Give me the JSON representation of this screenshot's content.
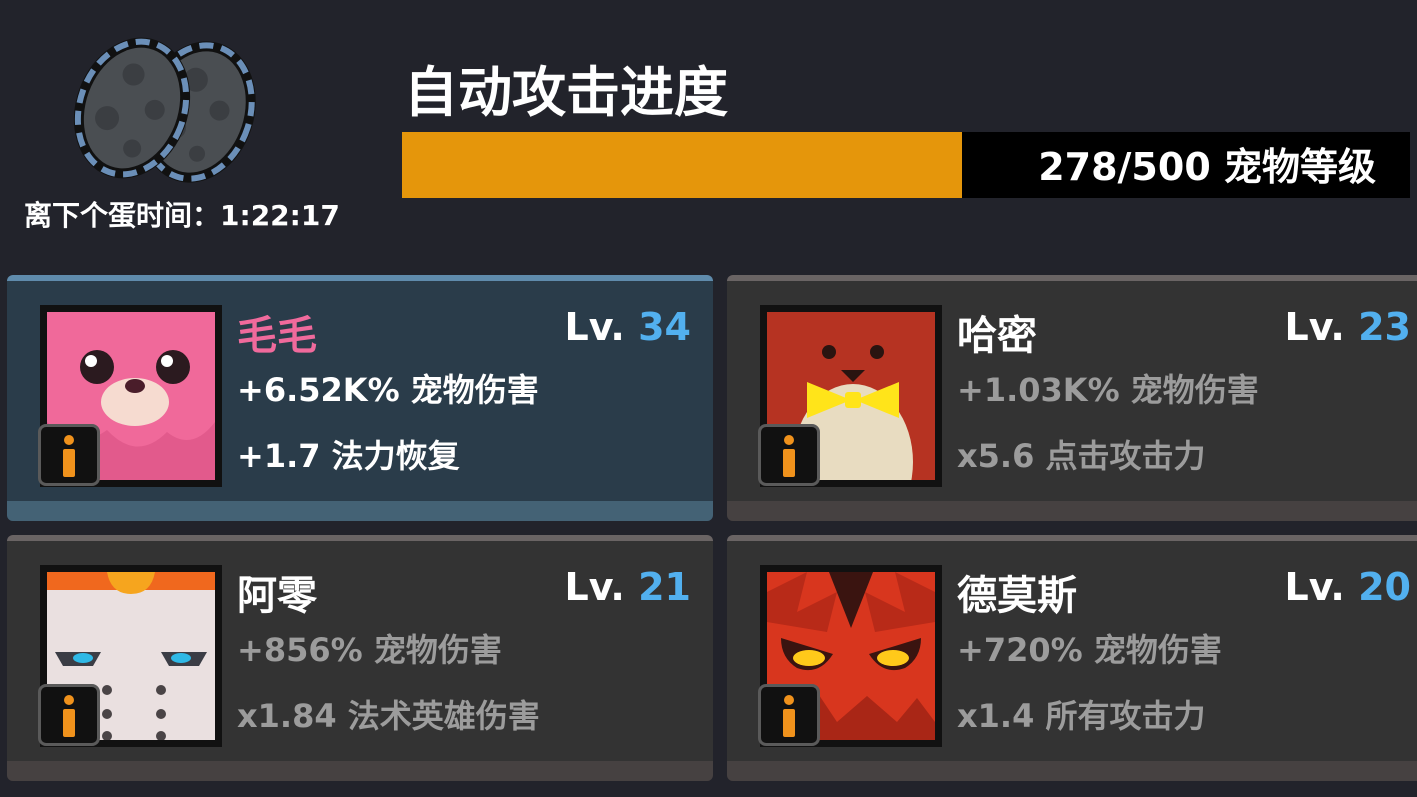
{
  "header": {
    "title": "自动攻击进度",
    "egg_timer_label": "离下个蛋时间：",
    "egg_timer_value": "1:22:17",
    "progress_text": "278/500 宠物等级",
    "progress_current": 278,
    "progress_max": 500,
    "progress_color": "#e5960b"
  },
  "pets": [
    {
      "name": "毛毛",
      "level_prefix": "Lv.",
      "level": "34",
      "stat1": "+6.52K% 宠物伤害",
      "stat2": "+1.7 法力恢复",
      "selected": true,
      "icon": "pink-seal-pet-icon"
    },
    {
      "name": "哈密",
      "level_prefix": "Lv.",
      "level": "23",
      "stat1": "+1.03K% 宠物伤害",
      "stat2": "x5.6 点击攻击力",
      "selected": false,
      "icon": "penguin-bowtie-pet-icon"
    },
    {
      "name": "阿零",
      "level_prefix": "Lv.",
      "level": "21",
      "stat1": "+856% 宠物伤害",
      "stat2": "x1.84 法术英雄伤害",
      "selected": false,
      "icon": "robot-pet-icon"
    },
    {
      "name": "德莫斯",
      "level_prefix": "Lv.",
      "level": "20",
      "stat1": "+720% 宠物伤害",
      "stat2": "x1.4 所有攻击力",
      "selected": false,
      "icon": "red-demon-pet-icon"
    }
  ],
  "colors": {
    "background": "#22232b",
    "level_number": "#52b0ef",
    "selected_name": "#f06a9c",
    "info_icon": "#f0921c"
  }
}
